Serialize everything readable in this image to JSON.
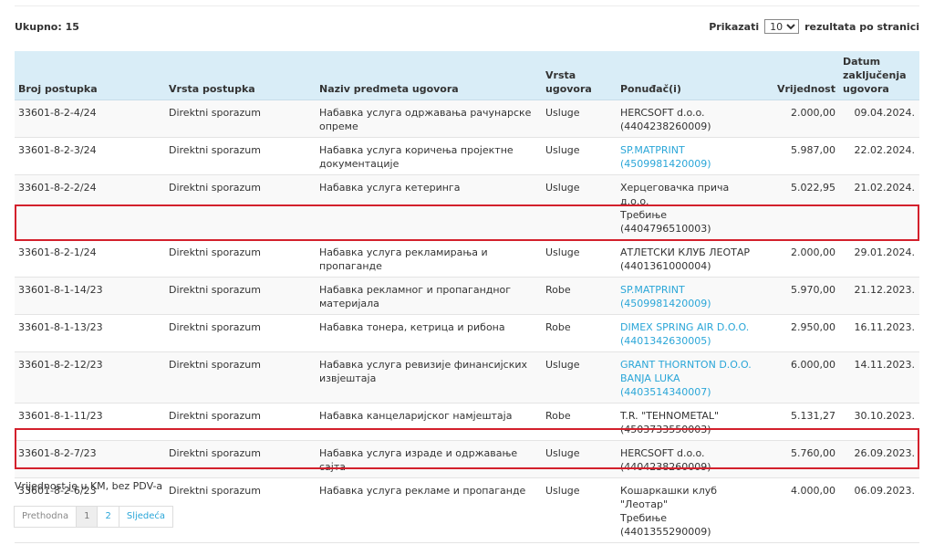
{
  "summary": {
    "total_label": "Ukupno: 15"
  },
  "page_size": {
    "label_before": "Prikazati",
    "value": "10",
    "label_after": "rezultata po stranici"
  },
  "columns": {
    "broj": "Broj postupka",
    "vrsta_postupka": "Vrsta postupka",
    "naziv": "Naziv predmeta ugovora",
    "vrsta_ugovora": "Vrsta ugovora",
    "ponudjac": "Ponuđač(i)",
    "vrijednost": "Vrijednost",
    "datum": "Datum zaključenja ugovora"
  },
  "rows": [
    {
      "broj": "33601-8-2-4/24",
      "vrsta_postupka": "Direktni sporazum",
      "naziv": "Набавка услуга одржавања рачунарске опреме",
      "vrsta_ugovora": "Usluge",
      "ponudjac_name": "HERCSOFT d.o.o.",
      "ponudjac_id": "(4404238260009)",
      "ponudjac_link": false,
      "vrijednost": "2.000,00",
      "datum": "09.04.2024."
    },
    {
      "broj": "33601-8-2-3/24",
      "vrsta_postupka": "Direktni sporazum",
      "naziv": "Набавка услуга коричења пројектне документације",
      "vrsta_ugovora": "Usluge",
      "ponudjac_name": "SP.MATPRINT",
      "ponudjac_id": "(4509981420009)",
      "ponudjac_link": true,
      "vrijednost": "5.987,00",
      "datum": "22.02.2024."
    },
    {
      "broj": "33601-8-2-2/24",
      "vrsta_postupka": "Direktni sporazum",
      "naziv": "Набавка услуга кетеринга",
      "vrsta_ugovora": "Usluge",
      "ponudjac_name": "Херцеговачка прича д.о.о.",
      "ponudjac_id": "Требиње (4404796510003)",
      "ponudjac_link": false,
      "vrijednost": "5.022,95",
      "datum": "21.02.2024."
    },
    {
      "broj": "33601-8-2-1/24",
      "vrsta_postupka": "Direktni sporazum",
      "naziv": "Набавка услуга рекламирања и пропаганде",
      "vrsta_ugovora": "Usluge",
      "ponudjac_name": "АТЛЕТСКИ КЛУБ ЛЕОТАР",
      "ponudjac_id": "(4401361000004)",
      "ponudjac_link": false,
      "vrijednost": "2.000,00",
      "datum": "29.01.2024."
    },
    {
      "broj": "33601-8-1-14/23",
      "vrsta_postupka": "Direktni sporazum",
      "naziv": "Набавка рекламног и пропагандног материјала",
      "vrsta_ugovora": "Robe",
      "ponudjac_name": "SP.MATPRINT",
      "ponudjac_id": "(4509981420009)",
      "ponudjac_link": true,
      "vrijednost": "5.970,00",
      "datum": "21.12.2023."
    },
    {
      "broj": "33601-8-1-13/23",
      "vrsta_postupka": "Direktni sporazum",
      "naziv": "Набавка тонера, кетрица и рибона",
      "vrsta_ugovora": "Robe",
      "ponudjac_name": "DIMEX SPRING AIR D.O.O.",
      "ponudjac_id": "(4401342630005)",
      "ponudjac_link": true,
      "vrijednost": "2.950,00",
      "datum": "16.11.2023."
    },
    {
      "broj": "33601-8-2-12/23",
      "vrsta_postupka": "Direktni sporazum",
      "naziv": "Набавка услуга ревизије финансијских извјештаја",
      "vrsta_ugovora": "Usluge",
      "ponudjac_name": "GRANT THORNTON D.O.O. BANJA LUKA",
      "ponudjac_id": "(4403514340007)",
      "ponudjac_link": true,
      "vrijednost": "6.000,00",
      "datum": "14.11.2023."
    },
    {
      "broj": "33601-8-1-11/23",
      "vrsta_postupka": "Direktni sporazum",
      "naziv": "Набавка канцеларијског намјештаја",
      "vrsta_ugovora": "Robe",
      "ponudjac_name": "T.R. \"TEHNOMETAL\"",
      "ponudjac_id": "(4503733550003)",
      "ponudjac_link": false,
      "vrijednost": "5.131,27",
      "datum": "30.10.2023."
    },
    {
      "broj": "33601-8-2-7/23",
      "vrsta_postupka": "Direktni sporazum",
      "naziv": "Набавка услуга израде и одржавање сајта",
      "vrsta_ugovora": "Usluge",
      "ponudjac_name": "HERCSOFT d.o.o.",
      "ponudjac_id": "(4404238260009)",
      "ponudjac_link": false,
      "vrijednost": "5.760,00",
      "datum": "26.09.2023."
    },
    {
      "broj": "33601-8-2-6/23",
      "vrsta_postupka": "Direktni sporazum",
      "naziv": "Набавка услуга рекламе и пропаганде",
      "vrsta_ugovora": "Usluge",
      "ponudjac_name": "Кошаркашки клуб \"Леотар\"",
      "ponudjac_id": "Требиње (4401355290009)",
      "ponudjac_link": false,
      "vrijednost": "4.000,00",
      "datum": "06.09.2023."
    }
  ],
  "footnote": "Vrijednost je u KM, bez PDV-a",
  "pagination": {
    "prev": "Prethodna",
    "pages": [
      "1",
      "2"
    ],
    "current": "1",
    "next": "Sljedeća"
  }
}
